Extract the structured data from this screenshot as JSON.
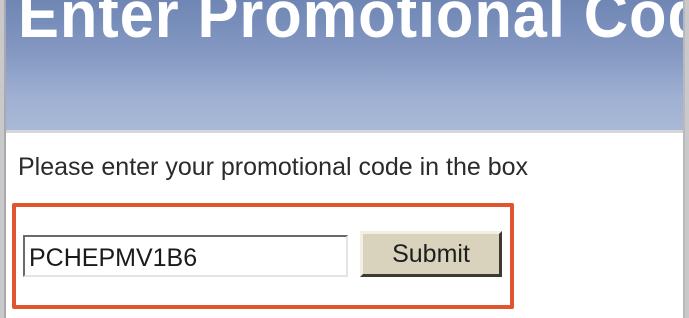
{
  "page": {
    "banner_title": "Enter Promotional Cod",
    "instruction": "Please enter your promotional code in the box"
  },
  "form": {
    "code_value": "PCHEPMV1B6",
    "submit_label": "Submit"
  },
  "colors": {
    "banner": "#8498c2",
    "highlight_border": "#e0552f",
    "button_face": "#d9d2bd",
    "page_background": "#ffffff"
  }
}
